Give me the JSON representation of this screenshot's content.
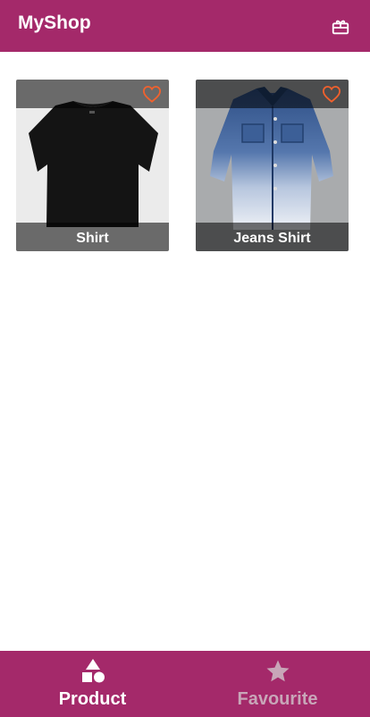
{
  "app": {
    "title": "MyShop",
    "action_icon": "gift-card-icon",
    "bar_color": "#a4296a"
  },
  "products": [
    {
      "label": "Shirt",
      "image": "black-tshirt-image",
      "favourite_icon": "heart-outline-icon"
    },
    {
      "label": "Jeans Shirt",
      "image": "denim-shirt-image",
      "favourite_icon": "heart-outline-icon"
    }
  ],
  "colors": {
    "accent": "#a4296a",
    "favourite_icon": "#f2612d",
    "nav_inactive": "#c8a6b8"
  },
  "bottom_nav": {
    "items": [
      {
        "label": "Product",
        "icon": "shapes-icon",
        "active": true
      },
      {
        "label": "Favourite",
        "icon": "star-icon",
        "active": false
      }
    ]
  }
}
